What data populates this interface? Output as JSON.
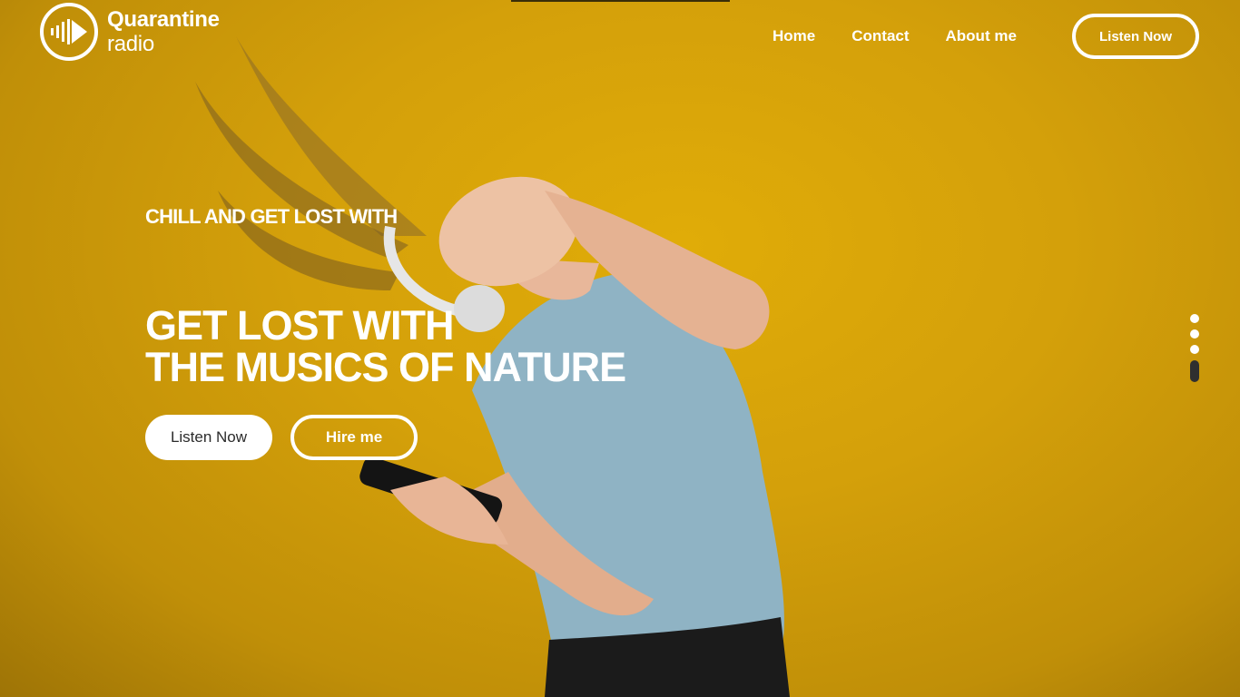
{
  "brand": {
    "name_line1": "Quarantine",
    "name_line2": "radio",
    "logo_icon": "sound-wave-play-icon"
  },
  "nav": {
    "items": [
      "Home",
      "Contact",
      "About me"
    ],
    "cta_label": "Listen Now"
  },
  "hero": {
    "kicker": "CHILL AND GET LOST WITH",
    "headline_line1": "GET LOST WITH",
    "headline_line2": "THE MUSICS OF NATURE",
    "primary_button": "Listen Now",
    "secondary_button": "Hire me",
    "slides_count": 4,
    "active_slide": 4
  },
  "colors": {
    "background": "#d9a60a",
    "text": "#ffffff",
    "dot_active": "#2f2f2f"
  }
}
